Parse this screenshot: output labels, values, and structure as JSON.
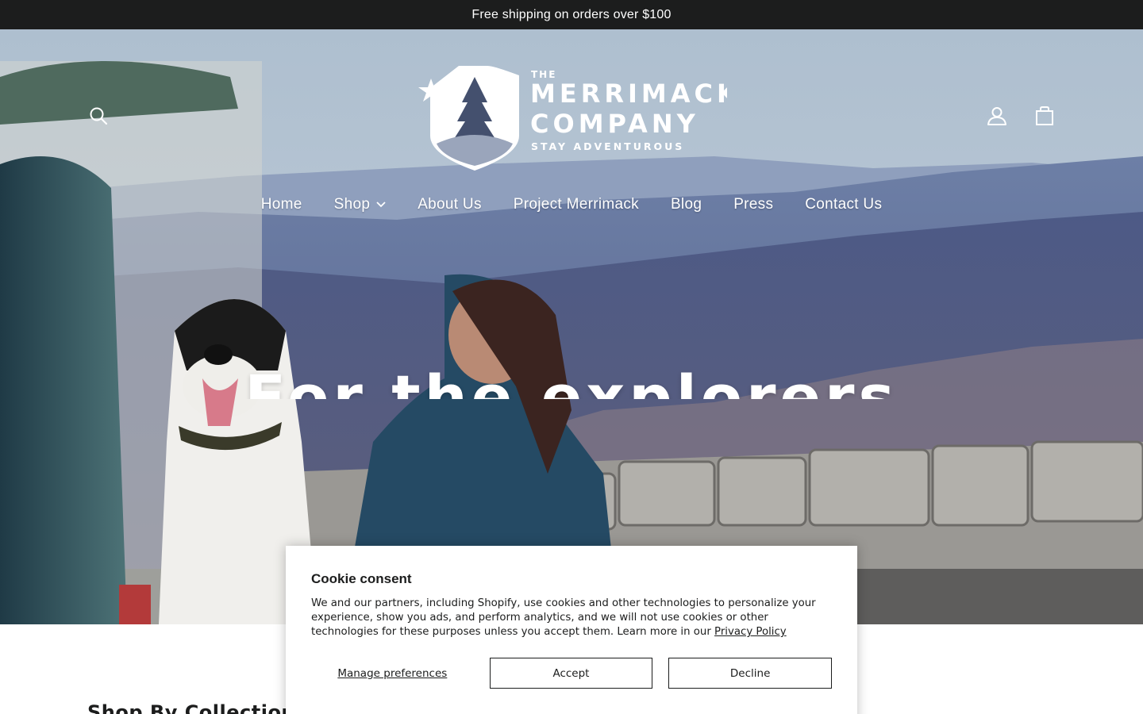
{
  "announcement": {
    "text": "Free shipping on orders over $100"
  },
  "header": {
    "logo": {
      "line1": "THE",
      "line2": "MERRIMACK",
      "line3": "COMPANY",
      "tagline": "STAY ADVENTUROUS"
    },
    "icons": {
      "search": "search-icon",
      "account": "user-icon",
      "cart": "shopping-bag-icon"
    }
  },
  "nav": {
    "items": [
      {
        "label": "Home"
      },
      {
        "label": "Shop"
      },
      {
        "label": "About Us"
      },
      {
        "label": "Project Merrimack"
      },
      {
        "label": "Blog"
      },
      {
        "label": "Press"
      },
      {
        "label": "Contact Us"
      }
    ]
  },
  "hero": {
    "heading": "For the explorers"
  },
  "section": {
    "title": "Shop By Collection"
  },
  "cookie": {
    "title": "Cookie consent",
    "body": "We and our partners, including Shopify, use cookies and other technologies to personalize your experience, show you ads, and perform analytics, and we will not use cookies or other technologies for these purposes unless you accept them. Learn more in our",
    "link": "Privacy Policy",
    "manage": "Manage preferences",
    "accept": "Accept",
    "decline": "Decline"
  },
  "colors": {
    "announce_bg": "#1c1d1d",
    "text": "#1c1d1d",
    "white": "#ffffff"
  }
}
